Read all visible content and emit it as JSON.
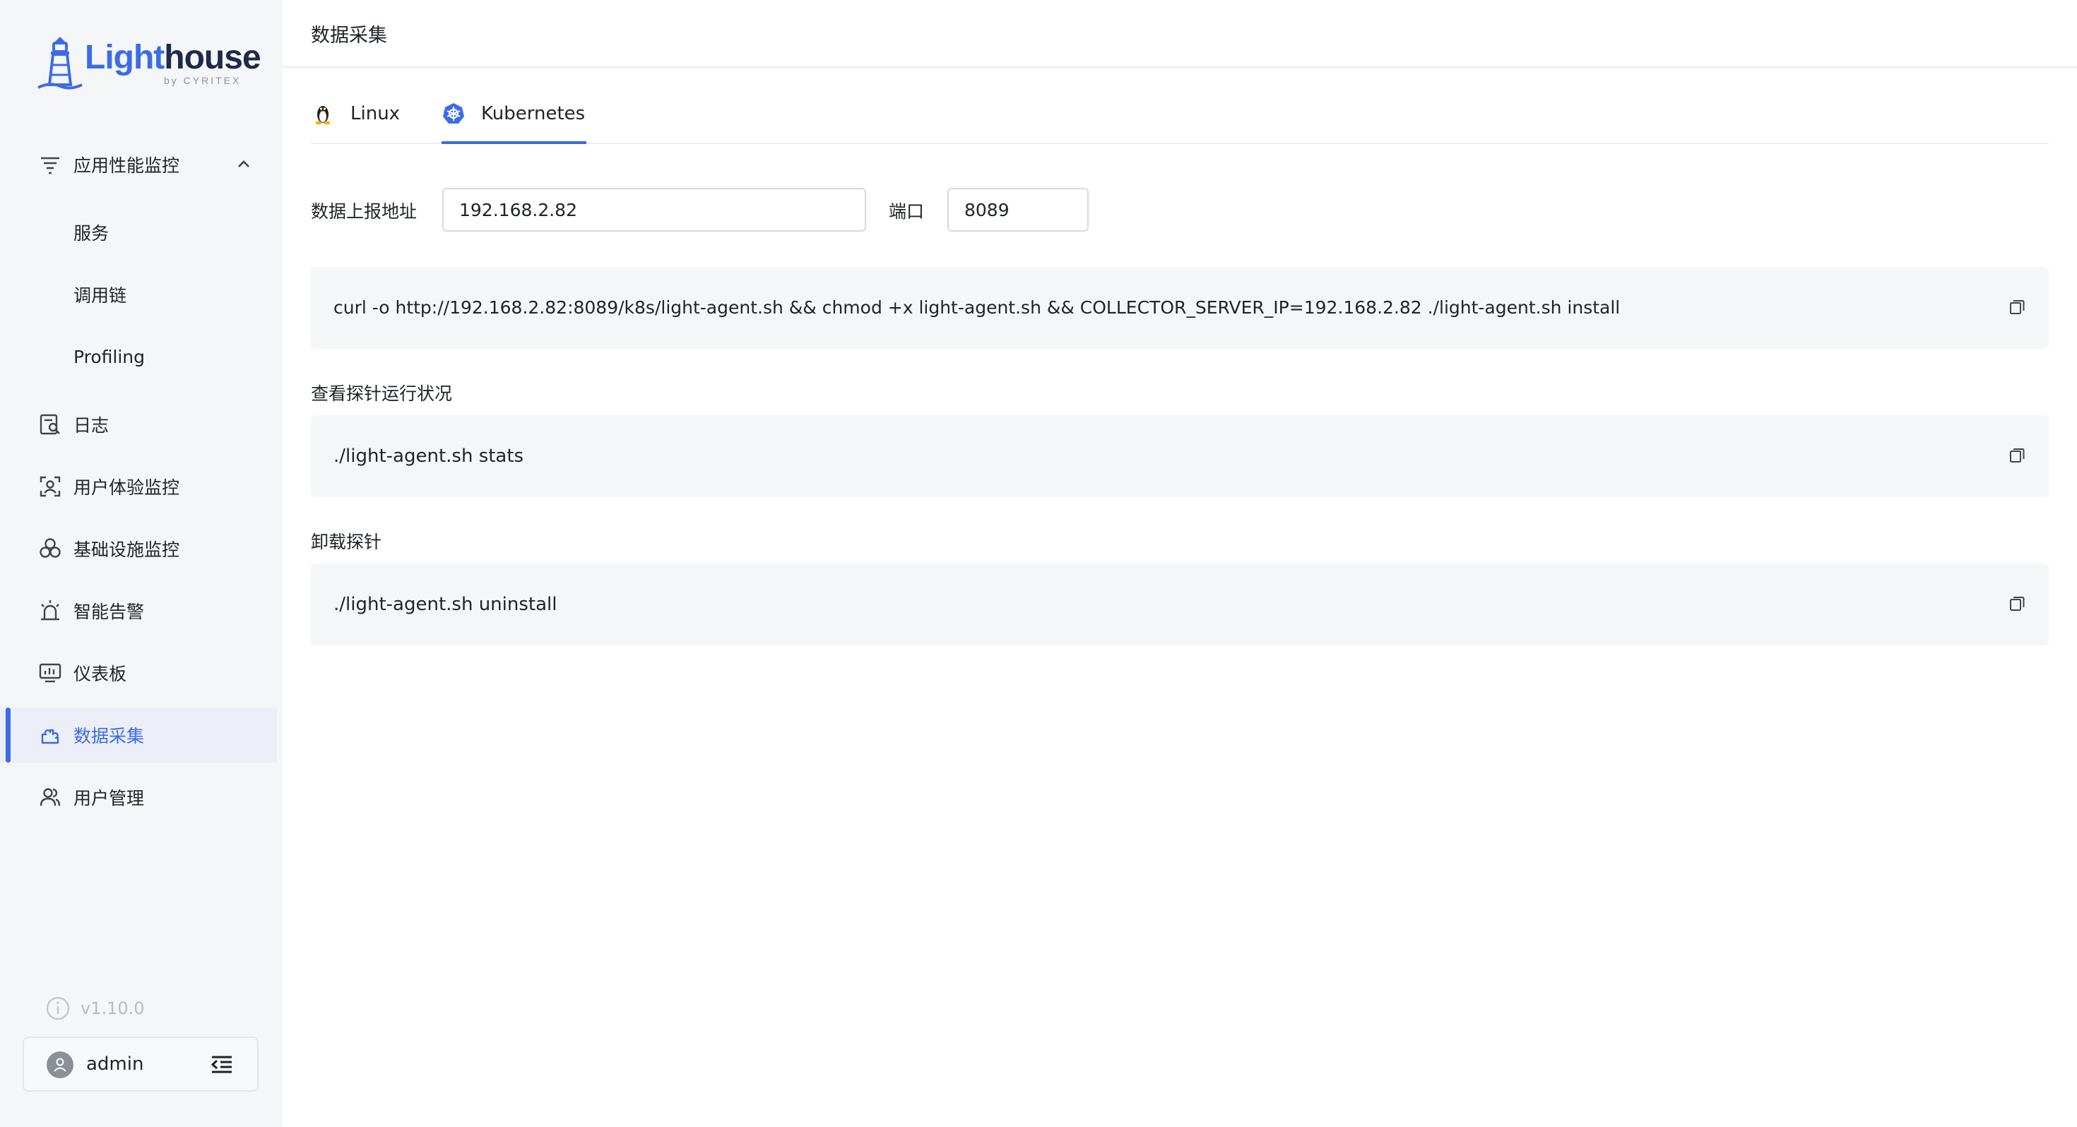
{
  "brand": {
    "name_part1": "Light",
    "name_part2": "house",
    "byline": "by CYRITEX"
  },
  "nav": {
    "apm": {
      "label": "应用性能监控"
    },
    "apm_children": [
      {
        "label": "服务"
      },
      {
        "label": "调用链"
      },
      {
        "label": "Profiling"
      }
    ],
    "items": [
      {
        "label": "日志",
        "icon": "log-search-icon"
      },
      {
        "label": "用户体验监控",
        "icon": "user-scan-icon"
      },
      {
        "label": "基础设施监控",
        "icon": "infrastructure-icon"
      },
      {
        "label": "智能告警",
        "icon": "alarm-icon"
      },
      {
        "label": "仪表板",
        "icon": "dashboard-icon"
      },
      {
        "label": "数据采集",
        "icon": "puzzle-icon",
        "active": true
      },
      {
        "label": "用户管理",
        "icon": "users-icon"
      }
    ]
  },
  "version": "v1.10.0",
  "user": {
    "name": "admin"
  },
  "header": {
    "title": "数据采集"
  },
  "tabs": [
    {
      "label": "Linux",
      "icon": "linux-icon"
    },
    {
      "label": "Kubernetes",
      "icon": "kubernetes-icon",
      "active": true
    }
  ],
  "form": {
    "address_label": "数据上报地址",
    "address_value": "192.168.2.82",
    "port_label": "端口",
    "port_value": "8089"
  },
  "commands": {
    "install": "curl -o http://192.168.2.82:8089/k8s/light-agent.sh && chmod +x light-agent.sh && COLLECTOR_SERVER_IP=192.168.2.82 ./light-agent.sh install",
    "status_label": "查看探针运行状况",
    "status": "./light-agent.sh stats",
    "uninstall_label": "卸载探针",
    "uninstall": "./light-agent.sh uninstall"
  },
  "colors": {
    "accent": "#3b6ce8",
    "sidebar_bg": "#f5f6f8",
    "code_bg": "#f5f6f8"
  }
}
